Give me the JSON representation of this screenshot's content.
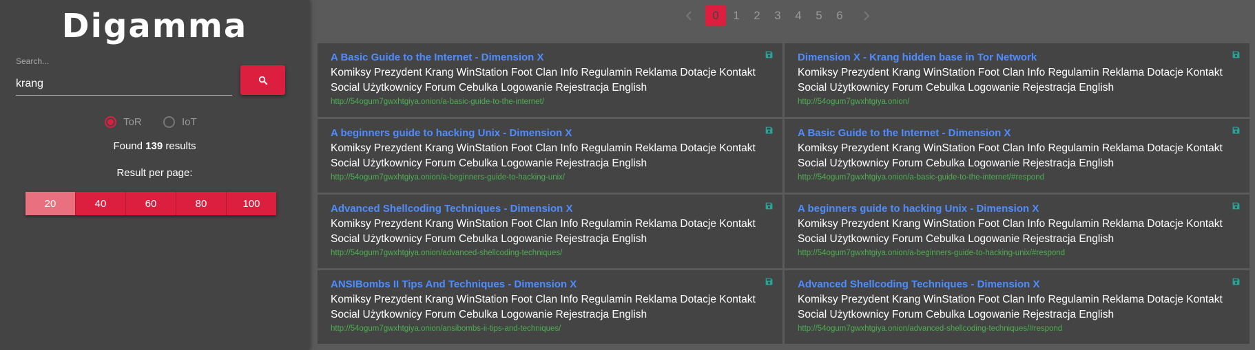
{
  "app": {
    "logo": "Digamma"
  },
  "search": {
    "label": "Search...",
    "value": "krang"
  },
  "networks": [
    {
      "label": "ToR",
      "selected": true
    },
    {
      "label": "IoT",
      "selected": false
    }
  ],
  "found": {
    "prefix": "Found ",
    "count": "139",
    "suffix": " results"
  },
  "per_page": {
    "label": "Result per page:",
    "options": [
      "20",
      "40",
      "60",
      "80",
      "100"
    ],
    "active": "20"
  },
  "pagination": {
    "pages": [
      "0",
      "1",
      "2",
      "3",
      "4",
      "5",
      "6"
    ],
    "active": "0"
  },
  "results": [
    {
      "title": "A Basic Guide to the Internet - Dimension X",
      "snippet": "Komiksy Prezydent Krang WinStation Foot Clan Info Regulamin Reklama Dotacje Kontakt Social Użytkownicy Forum Cebulka Logowanie Rejestracja English",
      "url": "http://54ogum7gwxhtgiya.onion/a-basic-guide-to-the-internet/"
    },
    {
      "title": "Dimension X - Krang hidden base in Tor Network",
      "snippet": "Komiksy Prezydent Krang WinStation Foot Clan Info Regulamin Reklama Dotacje Kontakt Social Użytkownicy Forum Cebulka Logowanie Rejestracja English",
      "url": "http://54ogum7gwxhtgiya.onion/"
    },
    {
      "title": "A beginners guide to hacking Unix - Dimension X",
      "snippet": "Komiksy Prezydent Krang WinStation Foot Clan Info Regulamin Reklama Dotacje Kontakt Social Użytkownicy Forum Cebulka Logowanie Rejestracja English",
      "url": "http://54ogum7gwxhtgiya.onion/a-beginners-guide-to-hacking-unix/"
    },
    {
      "title": "A Basic Guide to the Internet - Dimension X",
      "snippet": "Komiksy Prezydent Krang WinStation Foot Clan Info Regulamin Reklama Dotacje Kontakt Social Użytkownicy Forum Cebulka Logowanie Rejestracja English",
      "url": "http://54ogum7gwxhtgiya.onion/a-basic-guide-to-the-internet/#respond"
    },
    {
      "title": "Advanced Shellcoding Techniques - Dimension X",
      "snippet": "Komiksy Prezydent Krang WinStation Foot Clan Info Regulamin Reklama Dotacje Kontakt Social Użytkownicy Forum Cebulka Logowanie Rejestracja English",
      "url": "http://54ogum7gwxhtgiya.onion/advanced-shellcoding-techniques/"
    },
    {
      "title": "A beginners guide to hacking Unix - Dimension X",
      "snippet": "Komiksy Prezydent Krang WinStation Foot Clan Info Regulamin Reklama Dotacje Kontakt Social Użytkownicy Forum Cebulka Logowanie Rejestracja English",
      "url": "http://54ogum7gwxhtgiya.onion/a-beginners-guide-to-hacking-unix/#respond"
    },
    {
      "title": "ANSIBombs II Tips And Techniques - Dimension X",
      "snippet": "Komiksy Prezydent Krang WinStation Foot Clan Info Regulamin Reklama Dotacje Kontakt Social Użytkownicy Forum Cebulka Logowanie Rejestracja English",
      "url": "http://54ogum7gwxhtgiya.onion/ansibombs-ii-tips-and-techniques/"
    },
    {
      "title": "Advanced Shellcoding Techniques - Dimension X",
      "snippet": "Komiksy Prezydent Krang WinStation Foot Clan Info Regulamin Reklama Dotacje Kontakt Social Użytkownicy Forum Cebulka Logowanie Rejestracja English",
      "url": "http://54ogum7gwxhtgiya.onion/advanced-shellcoding-techniques/#respond"
    }
  ],
  "icons": {
    "search": "search-icon",
    "save": "save-icon",
    "prev": "chevron-left-icon",
    "next": "chevron-right-icon"
  },
  "colors": {
    "accent": "#dc1f3f",
    "link": "#4f8dff",
    "url": "#4caf50",
    "save_icon": "#26a69a"
  }
}
